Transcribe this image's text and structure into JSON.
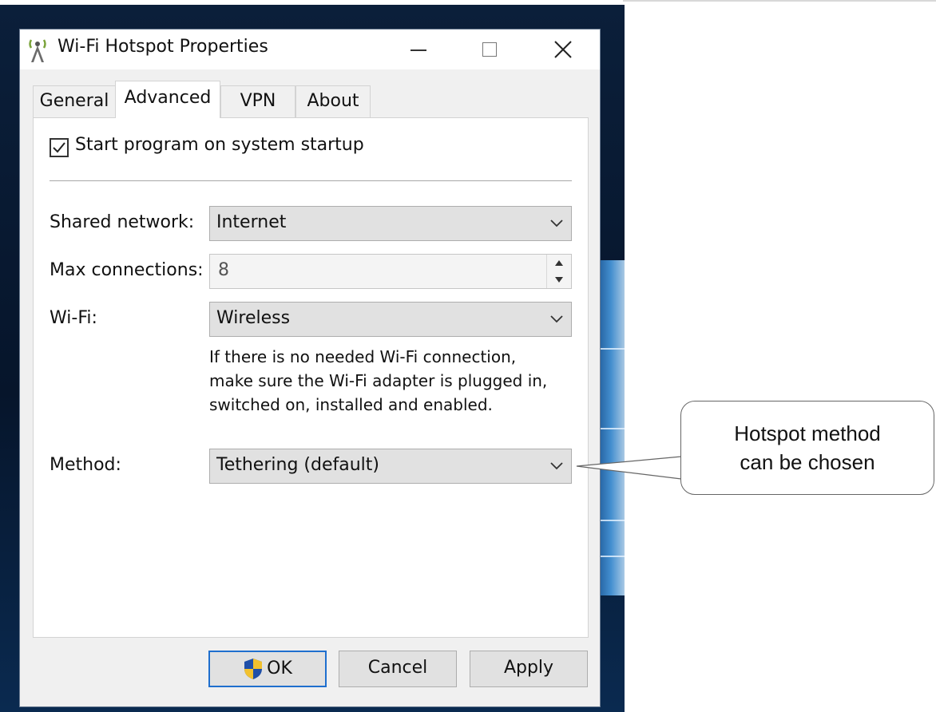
{
  "window": {
    "title": "Wi-Fi Hotspot Properties"
  },
  "tabs": [
    {
      "label": "General",
      "active": false
    },
    {
      "label": "Advanced",
      "active": true
    },
    {
      "label": "VPN",
      "active": false
    },
    {
      "label": "About",
      "active": false
    }
  ],
  "advanced": {
    "startup_checkbox": {
      "label": "Start program on system startup",
      "checked": true
    },
    "shared_network": {
      "label": "Shared network:",
      "value": "Internet"
    },
    "max_connections": {
      "label": "Max connections:",
      "value": "8"
    },
    "wifi": {
      "label": "Wi-Fi:",
      "value": "Wireless"
    },
    "hint_lines": [
      "If there is no needed Wi-Fi connection,",
      "make sure the Wi-Fi adapter is plugged in,",
      "switched on, installed and enabled."
    ],
    "method": {
      "label": "Method:",
      "value": "Tethering (default)"
    }
  },
  "buttons": {
    "ok": "OK",
    "cancel": "Cancel",
    "apply": "Apply"
  },
  "callout": {
    "lines": [
      "Hotspot method",
      "can be chosen"
    ]
  },
  "colors": {
    "focus_border": "#1f6fce",
    "window_bg": "#f0f0f0"
  }
}
